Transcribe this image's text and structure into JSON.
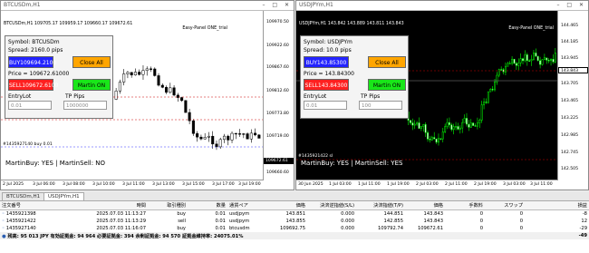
{
  "left_window": {
    "title": "BTCUSDm,H1",
    "header": "BTCUSDm,H1  109705.17  109959.17  109660.17  109672.61",
    "panel_name": "Easy-Panel ONE_trial",
    "symbol": "Symbol: BTCUSDm",
    "spread": "Spread: 2160.0 pips",
    "buy_label": "BUY109694.2100",
    "close_all": "Close All",
    "price": "Price = 109672.61000",
    "sell_label": "SELL109672.6100",
    "martin_on": "Martin ON",
    "entry_lot_label": "EntryLot",
    "tp_pips_label": "TP Pips",
    "entry_lot_value": "0.01",
    "tp_pips_value": "1000000",
    "order_label": "#1435927140 buy 0.01",
    "status": "MartinBuy: YES | MartinSell: NO",
    "price_ticks": [
      "109970.50",
      "109922.60",
      "109867.60",
      "109812.60",
      "109773.80",
      "109719.00",
      "109666.30",
      "109660.60"
    ],
    "current_price": "109672.61",
    "time_ticks": [
      "2 Jul 2025",
      "3 Jul 06:00",
      "3 Jul 08:00",
      "3 Jul 10:00",
      "3 Jul 11:00",
      "3 Jul 13:00",
      "3 Jul 15:00",
      "3 Jul 17:00",
      "3 Jul 19:00"
    ]
  },
  "right_window": {
    "title": "USDJPYm,H1",
    "header": "USDJPYm,H1  143.842  143.889  143.811  143.843",
    "panel_name": "Easy-Panel ONE_trial",
    "symbol": "Symbol: USDJPYm",
    "spread": "Spread: 10.0 pips",
    "buy_label": "BUY143.85300",
    "close_all": "Close All",
    "price": "Price = 143.84300",
    "sell_label": "SELL143.84300",
    "martin_on": "Martin ON",
    "entry_lot_label": "EntryLot",
    "tp_pips_label": "TP Pips",
    "entry_lot_value": "0.01",
    "tp_pips_value": "100",
    "order_label": "#1435921422 sl",
    "status": "MartinBuy: YES | MartinSell: YES",
    "price_ticks": [
      "144.465",
      "144.185",
      "143.945",
      "143.843",
      "143.705",
      "143.465",
      "143.225",
      "142.985",
      "142.745",
      "142.505"
    ],
    "current_price": "143.843",
    "time_ticks": [
      "30 Jun 2025",
      "1 Jul 03:00",
      "1 Jul 11:00",
      "1 Jul 19:00",
      "2 Jul 03:00",
      "2 Jul 11:00",
      "2 Jul 19:00",
      "3 Jul 03:00",
      "3 Jul 11:00"
    ]
  },
  "tabs": [
    "BTCUSDm,H1",
    "USDJPYm,H1"
  ],
  "terminal": {
    "headers": [
      "注文番号",
      "時間",
      "取引種別",
      "数量",
      "通貨ペア",
      "価格",
      "決済逆指値(S/L)",
      "決済指値(T/P)",
      "価格",
      "手数料",
      "スワップ",
      "損益"
    ],
    "rows": [
      [
        "1435921398",
        "2025.07.03 11:13:27",
        "buy",
        "0.01",
        "usdjpym",
        "143.851",
        "0.000",
        "144.851",
        "143.843",
        "0",
        "0",
        "-8"
      ],
      [
        "1435921422",
        "2025.07.03 11:13:29",
        "sell",
        "0.01",
        "usdjpym",
        "143.855",
        "0.000",
        "142.855",
        "143.843",
        "0",
        "0",
        "12"
      ],
      [
        "1435927140",
        "2025.07.03 11:16:07",
        "buy",
        "0.01",
        "btcusdm",
        "109692.75",
        "0.000",
        "109792.74",
        "109672.61",
        "0",
        "0",
        "-29"
      ]
    ],
    "balance": "残高: 95 013 JPY  有効証拠金: 94 964  必要証拠金: 394  余剰証拠金: 94 570  証拠金維持率: 24075.01%",
    "balance_total": "-49"
  },
  "colors": {
    "buy_bg": "#2323ff",
    "sell_bg": "#ff2020",
    "close_all_bg": "#ffa500",
    "martin_bg": "#19e619",
    "right_chart_bg": "#000000",
    "bull_candle_dark": "#00ff00"
  }
}
